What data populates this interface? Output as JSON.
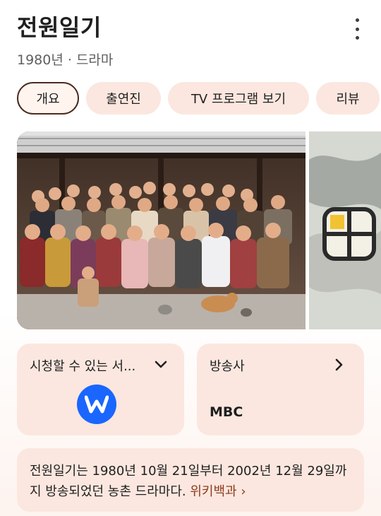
{
  "header": {
    "title": "전원일기",
    "subtitle": "1980년 · 드라마"
  },
  "chips": [
    {
      "label": "개요",
      "active": true
    },
    {
      "label": "출연진",
      "active": false
    },
    {
      "label": "TV 프로그램 보기",
      "active": false
    },
    {
      "label": "리뷰",
      "active": false
    }
  ],
  "images": {
    "main": "cast-group-photo",
    "side": "title-logo-artwork"
  },
  "watch_card": {
    "label": "시청할 수 있는 서...",
    "provider_icon": "watcha-logo"
  },
  "network_card": {
    "label": "방송사",
    "value": "MBC"
  },
  "description": {
    "text": "전원일기는 1980년 10월 21일부터 2002년 12월 29일까지 방송되었던 농촌 드라마다. ",
    "source": "위키백과",
    "source_arrow": "›"
  },
  "colors": {
    "chip_bg": "#fbe7df",
    "active_border": "#4a2a22",
    "link": "#8a3b1f",
    "watcha": "#1a66ff"
  }
}
